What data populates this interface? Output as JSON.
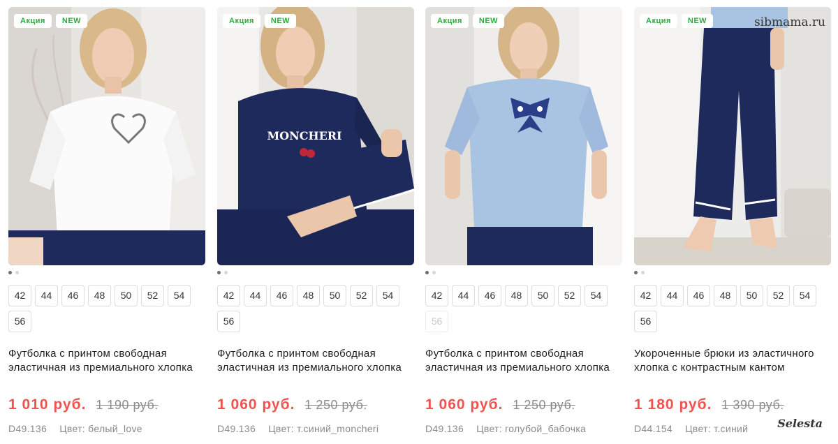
{
  "badges": {
    "sale": "Акция",
    "new": "NEW"
  },
  "products": [
    {
      "title": "Футболка с принтом свободная эластичная из премиального хлопка",
      "price": "1 010 руб.",
      "old_price": "1 190 руб.",
      "code": "D49.136",
      "color_label": "Цвет: белый_love",
      "sizes": [
        "42",
        "44",
        "46",
        "48",
        "50",
        "52",
        "54",
        "56"
      ],
      "disabled_sizes": []
    },
    {
      "title": "Футболка с принтом свободная эластичная из премиального хлопка",
      "price": "1 060 руб.",
      "old_price": "1 250 руб.",
      "code": "D49.136",
      "color_label": "Цвет: т.синий_moncheri",
      "sizes": [
        "42",
        "44",
        "46",
        "48",
        "50",
        "52",
        "54",
        "56"
      ],
      "disabled_sizes": []
    },
    {
      "title": "Футболка с принтом свободная эластичная из премиального хлопка",
      "price": "1 060 руб.",
      "old_price": "1 250 руб.",
      "code": "D49.136",
      "color_label": "Цвет: голубой_бабочка",
      "sizes": [
        "42",
        "44",
        "46",
        "48",
        "50",
        "52",
        "54",
        "56"
      ],
      "disabled_sizes": [
        "56"
      ]
    },
    {
      "title": "Укороченные брюки из эластичного хлопка с контрастным кантом",
      "price": "1 180 руб.",
      "old_price": "1 390 руб.",
      "code": "D44.154",
      "color_label": "Цвет: т.синий",
      "sizes": [
        "42",
        "44",
        "46",
        "48",
        "50",
        "52",
        "54",
        "56"
      ],
      "disabled_sizes": []
    }
  ],
  "print_text": "MONCHERI",
  "watermark_top": "sibmama.ru",
  "watermark_bottom": "Selesta",
  "colors": {
    "price": "#f0534f",
    "badge": "#2eaa3f",
    "navy": "#1f2a5c"
  }
}
